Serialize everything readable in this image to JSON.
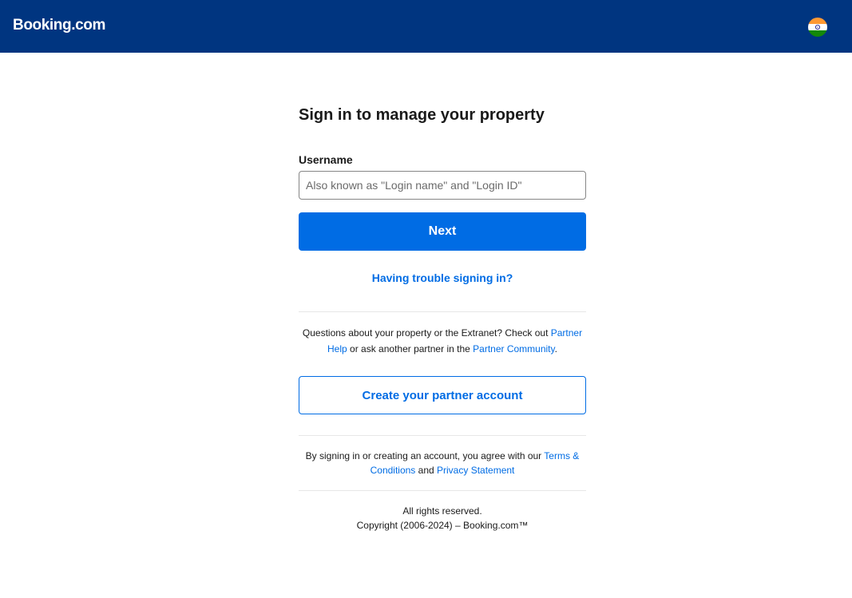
{
  "header": {
    "logo": "Booking.com",
    "flag_icon": "india-flag-icon"
  },
  "form": {
    "title": "Sign in to manage your property",
    "username_label": "Username",
    "username_placeholder": "Also known as \"Login name\" and \"Login ID\"",
    "username_value": "",
    "next_label": "Next",
    "trouble_link": "Having trouble signing in?"
  },
  "help": {
    "text_1": "Questions about your property or the Extranet? Check out ",
    "partner_help_link": "Partner Help",
    "text_2": " or ask another partner in the ",
    "community_link": "Partner Community",
    "text_3": "."
  },
  "create_account_label": "Create your partner account",
  "terms": {
    "text_1": "By signing in or creating an account, you agree with our ",
    "terms_link": "Terms & Conditions",
    "text_2": " and ",
    "privacy_link": "Privacy Statement"
  },
  "footer": {
    "rights": "All rights reserved.",
    "copyright": "Copyright (2006-2024) – Booking.com™"
  },
  "colors": {
    "header_bg": "#003580",
    "primary": "#006ce4",
    "text": "#1a1a1a",
    "divider": "#e7e7e7"
  }
}
